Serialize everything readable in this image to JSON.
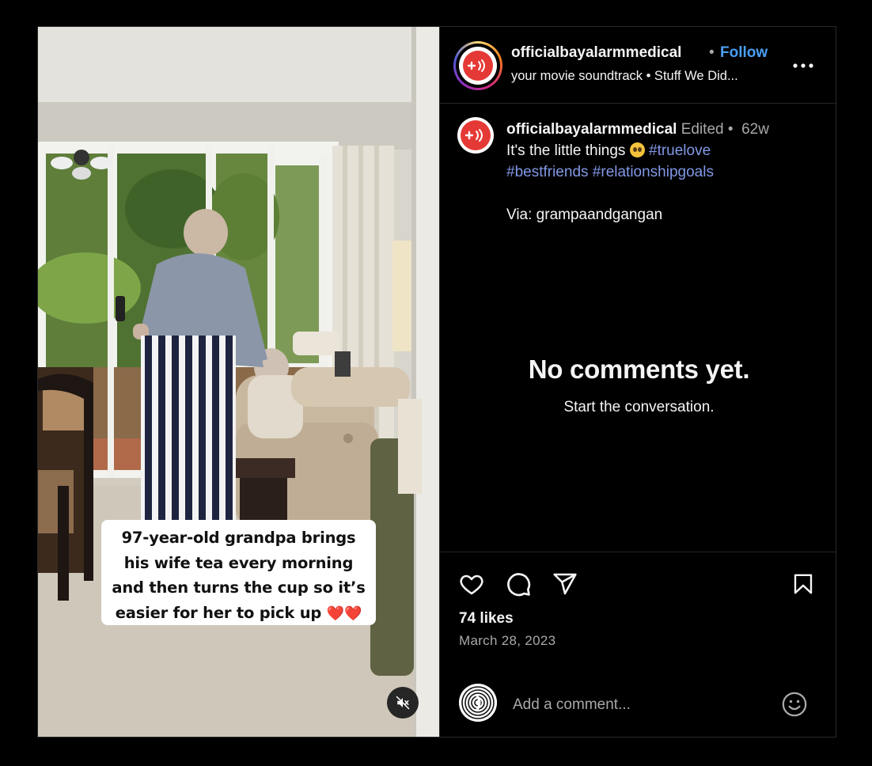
{
  "media": {
    "caption_lines": [
      "97-year-old grandpa brings",
      "his wife tea every morning",
      "and then turns the cup so it’s",
      "easier for her to pick up"
    ],
    "caption_hearts": "❤️❤️",
    "mute_icon": "speaker-muted-icon"
  },
  "header": {
    "username": "officialbayalarmmedical",
    "separator": "•",
    "follow_label": "Follow",
    "audio_text": "your movie soundtrack • Stuff We Did...",
    "more_icon": "more-horizontal-icon"
  },
  "post": {
    "username": "officialbayalarmmedical",
    "edited_label": "Edited",
    "separator": "•",
    "age": "62w",
    "caption_text": "It's the little things",
    "hashtags": [
      "#truelove",
      "#bestfriends",
      "#relationshipgoals"
    ],
    "via_text": "Via: grampaandgangan"
  },
  "comments": {
    "empty_title": "No comments yet.",
    "empty_subtitle": "Start the conversation."
  },
  "actions": {
    "like_icon": "heart-icon",
    "comment_icon": "comment-icon",
    "share_icon": "send-icon",
    "save_icon": "bookmark-icon",
    "likes_text": "74 likes",
    "date_text": "March 28, 2023"
  },
  "add_comment": {
    "placeholder": "Add a comment...",
    "emoji_icon": "smiley-icon"
  },
  "colors": {
    "background": "#000000",
    "link_blue": "#4a9ff5",
    "hashtag": "#8198e6",
    "muted_text": "#a8a8a8",
    "brand_red": "#e53935"
  }
}
